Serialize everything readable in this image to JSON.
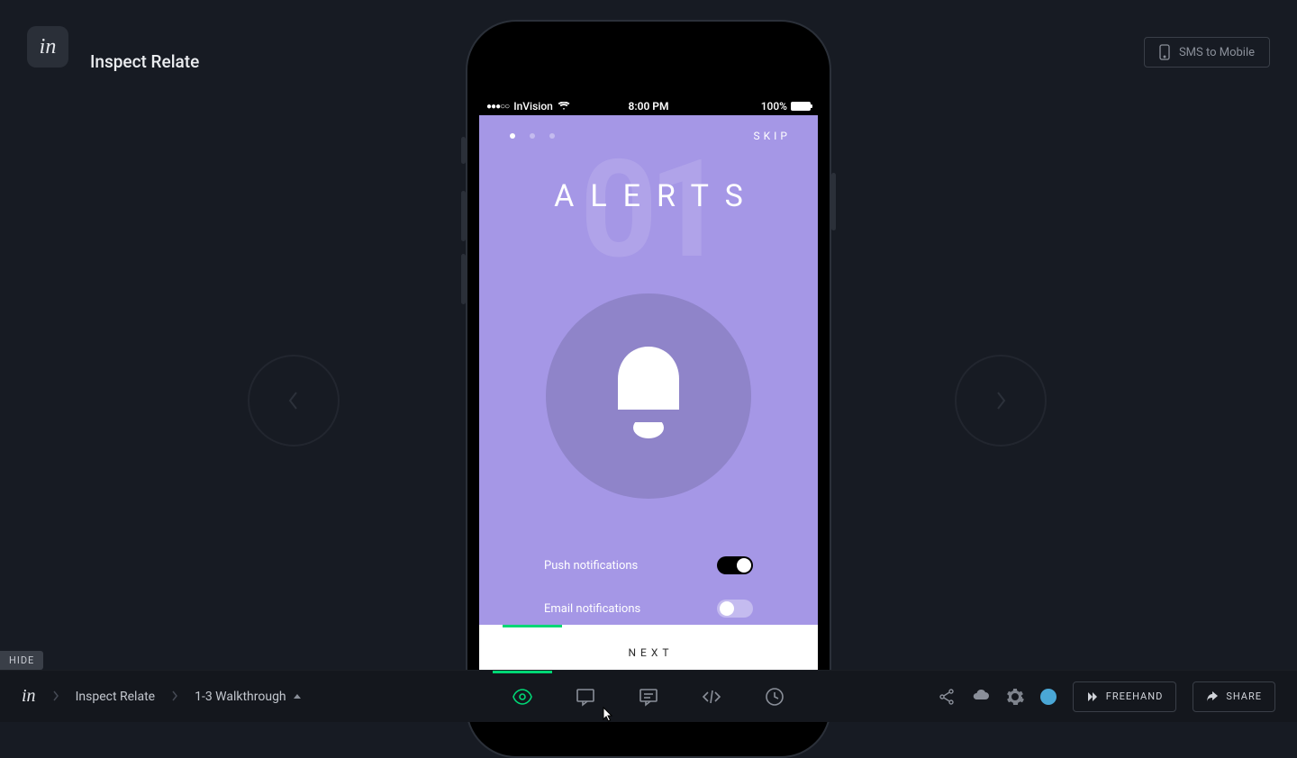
{
  "header": {
    "logo_text": "in",
    "project_title": "Inspect Relate",
    "sms_button": "SMS to Mobile"
  },
  "hide_badge": "HIDE",
  "phone": {
    "status": {
      "carrier": "InVision",
      "time": "8:00 PM",
      "battery_pct": "100%"
    },
    "skip_label": "SKIP",
    "big_number": "01",
    "title": "ALERTS",
    "settings": [
      {
        "label": "Push notifications",
        "state": "on"
      },
      {
        "label": "Email notifications",
        "state": "off"
      }
    ],
    "next_label": "NEXT"
  },
  "toolbar": {
    "logo_text": "in",
    "crumbs": [
      "Inspect Relate",
      "1-3 Walkthrough"
    ],
    "freehand": "FREEHAND",
    "share": "SHARE"
  },
  "icons": {
    "preview": "eye-icon",
    "comment_mode": "comment-mode-icon",
    "comments": "comments-icon",
    "inspect": "code-icon",
    "history": "clock-icon",
    "share_net": "share-network-icon",
    "upload": "upload-cloud-icon",
    "settings": "gear-icon"
  }
}
